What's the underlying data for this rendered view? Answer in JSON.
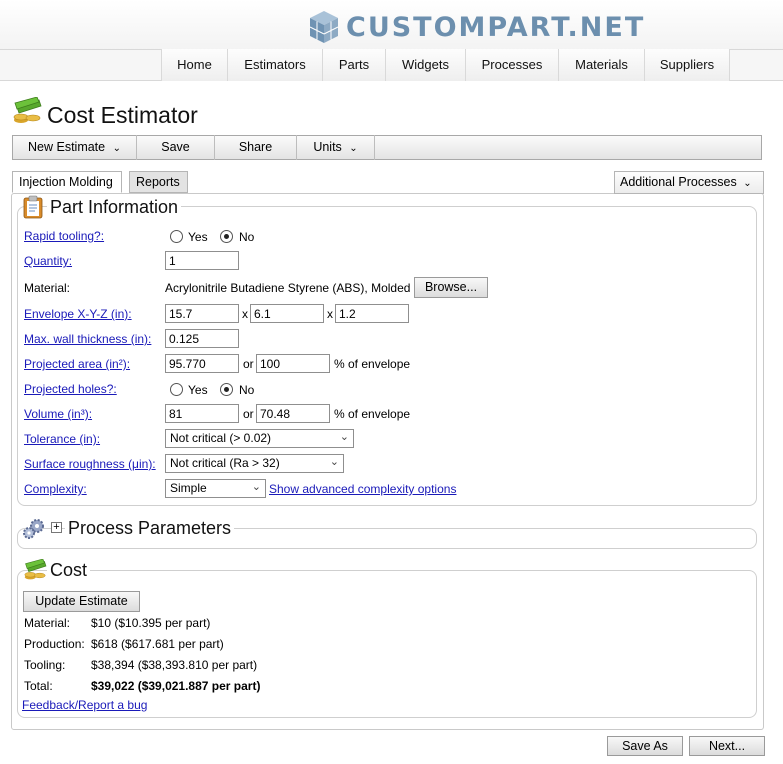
{
  "header": {
    "logo_text": "CUSTOMPART.NET",
    "nav": [
      "Home",
      "Estimators",
      "Parts",
      "Widgets",
      "Processes",
      "Materials",
      "Suppliers"
    ]
  },
  "page_title": "Cost Estimator",
  "toolbar": {
    "new_estimate": "New Estimate",
    "save": "Save",
    "share": "Share",
    "units": "Units"
  },
  "tabs": {
    "injection": "Injection Molding",
    "reports": "Reports",
    "additional_processes": "Additional Processes"
  },
  "part_info": {
    "title": "Part Information",
    "rapid_tooling": {
      "label": "Rapid tooling?:",
      "yes": "Yes",
      "no": "No",
      "selected": "No"
    },
    "quantity": {
      "label": "Quantity:",
      "value": "1"
    },
    "material": {
      "label": "Material:",
      "value": "Acrylonitrile Butadiene Styrene (ABS), Molded",
      "browse": "Browse..."
    },
    "envelope": {
      "label": "Envelope X-Y-Z (in):",
      "x": "15.7",
      "y": "6.1",
      "z": "1.2",
      "sep": "x"
    },
    "max_wall": {
      "label": "Max. wall thickness (in):",
      "value": "0.125"
    },
    "projected_area": {
      "label": "Projected area (in²):",
      "value": "95.770",
      "or": "or",
      "percent": "100",
      "suffix": "% of envelope"
    },
    "projected_holes": {
      "label": "Projected holes?:",
      "yes": "Yes",
      "no": "No",
      "selected": "No"
    },
    "volume": {
      "label": "Volume (in³):",
      "value": "81",
      "or": "or",
      "percent": "70.48",
      "suffix": "% of envelope"
    },
    "tolerance": {
      "label": "Tolerance (in):",
      "value": "Not critical (> 0.02)"
    },
    "roughness": {
      "label": "Surface roughness (μin):",
      "value": "Not critical (Ra > 32)"
    },
    "complexity": {
      "label": "Complexity:",
      "value": "Simple",
      "advanced_link": "Show advanced complexity options"
    }
  },
  "process_params": {
    "title": "Process Parameters",
    "toggle": "+"
  },
  "cost": {
    "title": "Cost",
    "update_button": "Update Estimate",
    "rows": [
      {
        "label": "Material:",
        "value": "$10 ($10.395 per part)"
      },
      {
        "label": "Production:",
        "value": "$618 ($617.681 per part)"
      },
      {
        "label": "Tooling:",
        "value": "$38,394 ($38,393.810 per part)"
      },
      {
        "label": "Total:",
        "value": "$39,022 ($39,021.887 per part)"
      }
    ],
    "feedback": "Feedback/Report a bug"
  },
  "footer": {
    "save_as": "Save As",
    "next": "Next..."
  },
  "colors": {
    "logo": "#6c8fae",
    "link": "#1a1ab9",
    "icon_green": "#58a82c",
    "icon_gold": "#d9a52a"
  }
}
